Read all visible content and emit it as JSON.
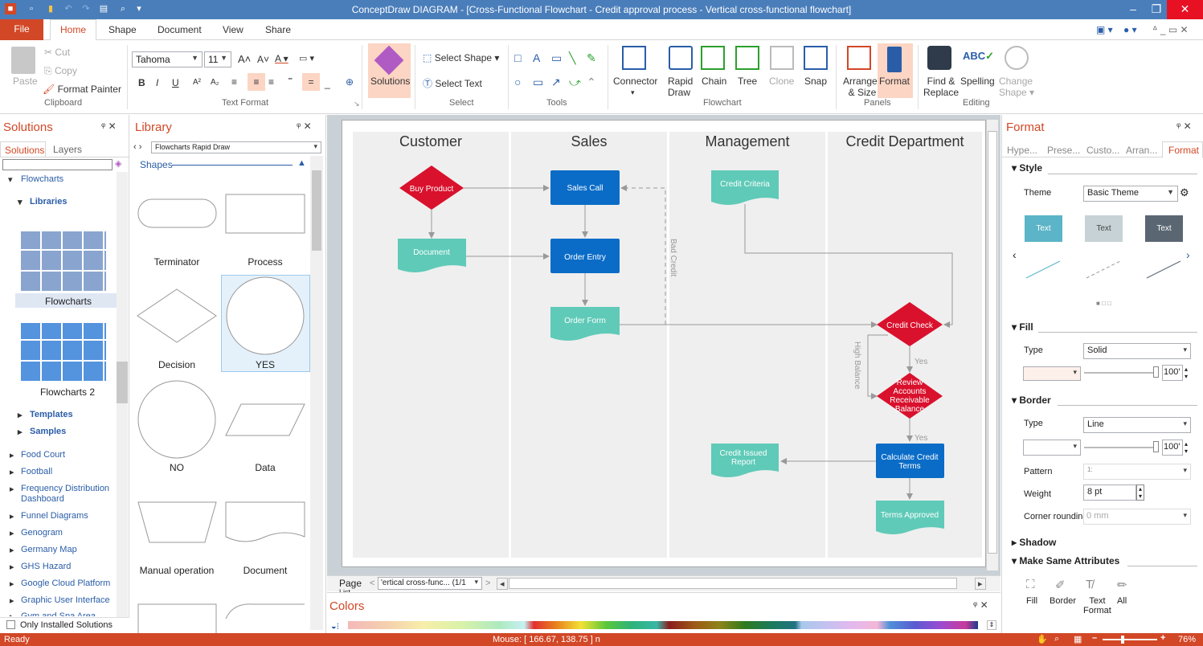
{
  "window": {
    "title": "ConceptDraw DIAGRAM - [Cross-Functional Flowchart - Credit approval process - Vertical cross-functional flowchart]"
  },
  "tabs": {
    "file": "File",
    "home": "Home",
    "shape": "Shape",
    "document": "Document",
    "view": "View",
    "share": "Share"
  },
  "clipboard": {
    "paste": "Paste",
    "cut": "Cut",
    "copy": "Copy",
    "format_painter": "Format Painter",
    "group": "Clipboard"
  },
  "text_format": {
    "font": "Tahoma",
    "size": "11",
    "group": "Text Format"
  },
  "solutions_btn": "Solutions",
  "select": {
    "select_shape": "Select Shape",
    "select_text": "Select Text",
    "group": "Select"
  },
  "tools": {
    "group": "Tools"
  },
  "flowchart": {
    "connector": "Connector",
    "rapid": "Rapid",
    "draw": "Draw",
    "chain": "Chain",
    "tree": "Tree",
    "clone": "Clone",
    "snap": "Snap",
    "group": "Flowchart"
  },
  "panels": {
    "arrange": "Arrange",
    "size": "& Size",
    "format": "Format",
    "group": "Panels"
  },
  "editing": {
    "find": "Find &",
    "replace": "Replace",
    "spelling": "Spelling",
    "change": "Change",
    "shape": "Shape",
    "group": "Editing"
  },
  "solutions_panel": {
    "title": "Solutions",
    "tab_solutions": "Solutions",
    "tab_layers": "Layers",
    "flowcharts": "Flowcharts",
    "libraries": "Libraries",
    "lib1": "Flowcharts",
    "lib2": "Flowcharts 2",
    "templates": "Templates",
    "samples": "Samples",
    "items": [
      "Food Court",
      "Football",
      "Frequency Distribution",
      "Dashboard",
      "Funnel Diagrams",
      "Genogram",
      "Germany Map",
      "GHS Hazard",
      "Google Cloud Platform",
      "Graphic User Interface",
      "Gym and Spa Area"
    ],
    "only_installed": "Only Installed Solutions"
  },
  "library_panel": {
    "title": "Library",
    "selector": "Flowcharts Rapid Draw",
    "shapes": "Shapes",
    "labels": [
      "Terminator",
      "Process",
      "Decision",
      "YES",
      "NO",
      "Data",
      "Manual operation",
      "Document"
    ]
  },
  "diagram": {
    "lanes": [
      "Customer",
      "Sales",
      "Management",
      "Credit Department"
    ],
    "buy_product": "Buy Product",
    "sales_call": "Sales Call",
    "credit_criteria": "Credit Criteria",
    "document": "Document",
    "order_entry": "Order Entry",
    "order_form": "Order Form",
    "bad_credit": "Bad Credit",
    "credit_check": "Credit Check",
    "high_balance": "High Balance",
    "yes1": "Yes",
    "review": [
      "Review",
      "Accounts",
      "Receivable",
      "Balance"
    ],
    "yes2": "Yes",
    "credit_issued": [
      "Credit Issued",
      "Report"
    ],
    "calc": [
      "Calculate Credit",
      "Terms"
    ],
    "terms_approved": "Terms Approved"
  },
  "pagebar": {
    "page": "Page",
    "list": "List",
    "page_name": "'ertical cross-func... (1/1"
  },
  "colors_panel": {
    "title": "Colors"
  },
  "format_panel": {
    "title": "Format",
    "tabs": [
      "Hype...",
      "Prese...",
      "Custo...",
      "Arran...",
      "Format"
    ],
    "style": "Style",
    "theme_label": "Theme",
    "theme_value": "Basic Theme",
    "text_sample": "Text",
    "fill": "Fill",
    "type_label": "Type",
    "fill_type": "Solid",
    "percent": "100'",
    "border": "Border",
    "border_type": "Line",
    "pattern_label": "Pattern",
    "pattern_value": "1:",
    "weight_label": "Weight",
    "weight_value": "8 pt",
    "corner_label": "Corner rounding",
    "corner_value": "0 mm",
    "shadow": "Shadow",
    "make_same": "Make Same Attributes",
    "ms_fill": "Fill",
    "ms_border": "Border",
    "ms_text": "Text",
    "ms_format": "Format",
    "ms_all": "All"
  },
  "status": {
    "ready": "Ready",
    "mouse": "Mouse: [ 166.67, 138.75 ] n",
    "zoom": "76%"
  },
  "colors": {
    "accent": "#d24726",
    "title_bar": "#4a7ebb",
    "red_shape": "#d9112d",
    "blue_shape": "#0a6cc7",
    "teal_shape": "#5fcab8"
  }
}
